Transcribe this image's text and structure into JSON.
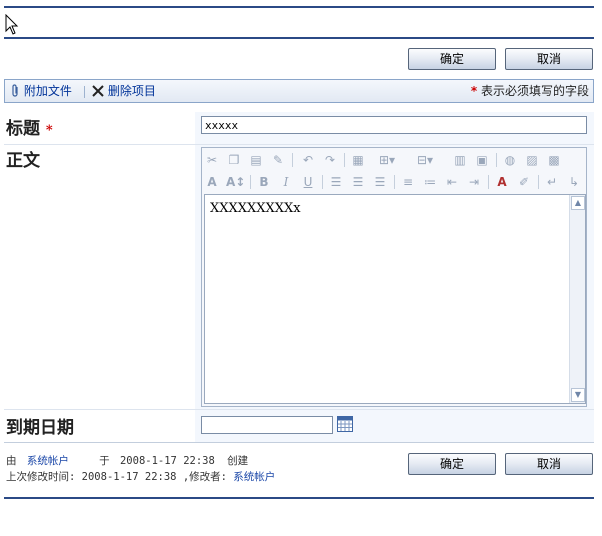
{
  "actions": {
    "ok_label": "确定",
    "cancel_label": "取消"
  },
  "toolbar": {
    "attach_label": "附加文件",
    "delete_label": "删除项目",
    "required_note": "表示必须填写的字段",
    "required_mark": "*"
  },
  "fields": {
    "title": {
      "label": "标题",
      "value": "xxxxx"
    },
    "body": {
      "label": "正文",
      "value": "XXXXXXXXXx"
    },
    "due_date": {
      "label": "到期日期",
      "value": ""
    }
  },
  "editor_toolbar": {
    "row1": [
      "cut-icon",
      "copy-icon",
      "paste-icon",
      "paste-plain-icon",
      "undo-icon",
      "redo-icon",
      "table-icon",
      "insert-row-icon",
      "insert-column-icon",
      "merge-cells-icon",
      "split-cells-icon",
      "hyperlink-icon",
      "image-icon",
      "grid-icon"
    ],
    "row2": [
      "font-size-icon",
      "font-grow-icon",
      "bold-icon",
      "italic-icon",
      "underline-icon",
      "align-left-icon",
      "align-center-icon",
      "align-right-icon",
      "numbered-list-icon",
      "bullet-list-icon",
      "outdent-icon",
      "indent-icon",
      "text-color-icon",
      "highlight-icon",
      "ltr-icon",
      "rtl-icon"
    ]
  },
  "meta": {
    "created_prefix": "由",
    "created_by": "系统帐户",
    "created_at_prefix": "于",
    "created_at": "2008-1-17 22:38",
    "created_suffix": "创建",
    "modified_prefix": "上次修改时间:",
    "modified_at": "2008-1-17 22:38",
    "modified_by_prefix": ",修改者:",
    "modified_by": "系统帐户"
  }
}
